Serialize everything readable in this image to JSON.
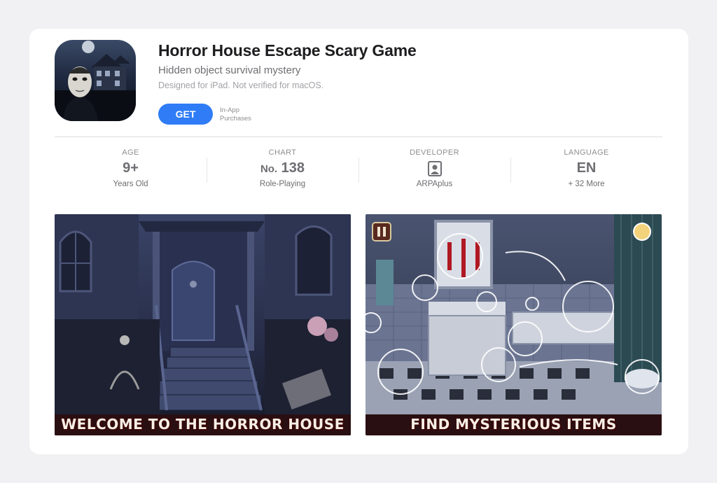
{
  "app": {
    "title": "Horror House Escape Scary Game",
    "subtitle": "Hidden object survival mystery",
    "compatibility": "Designed for iPad. Not verified for macOS.",
    "get_label": "GET",
    "iap_line1": "In-App",
    "iap_line2": "Purchases"
  },
  "stats": {
    "age": {
      "header": "AGE",
      "value": "9+",
      "sub": "Years Old"
    },
    "chart": {
      "header": "CHART",
      "prefix": "No.",
      "value": "138",
      "sub": "Role-Playing"
    },
    "developer": {
      "header": "DEVELOPER",
      "icon": "person-square-icon",
      "sub": "ARPAplus"
    },
    "language": {
      "header": "LANGUAGE",
      "value": "EN",
      "sub": "+ 32 More"
    }
  },
  "screenshots": [
    {
      "caption": "WELCOME TO THE HORROR HOUSE"
    },
    {
      "caption": "FIND MYSTERIOUS ITEMS"
    }
  ],
  "colors": {
    "accent": "#2f7cf6",
    "background": "#f1f1f3",
    "card": "#ffffff"
  }
}
